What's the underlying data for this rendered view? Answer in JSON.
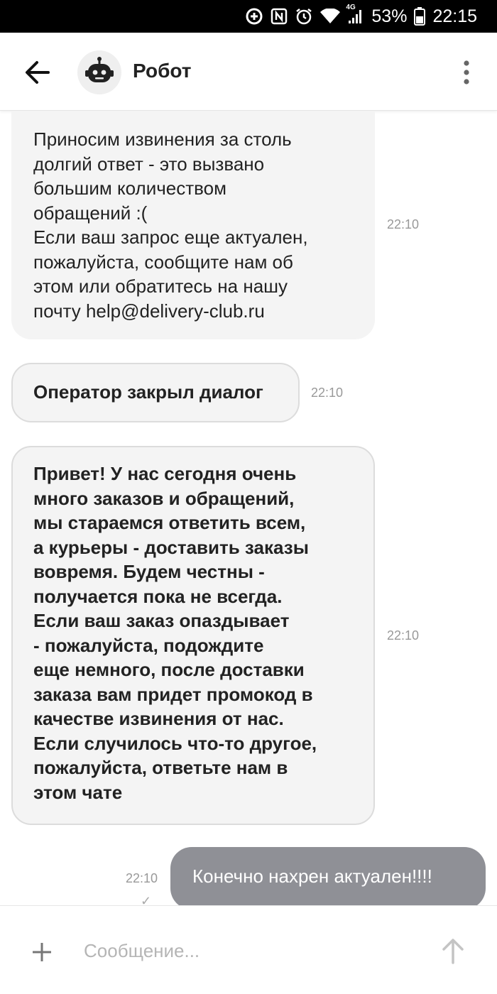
{
  "status_bar": {
    "battery": "53%",
    "time": "22:15",
    "network": "4G"
  },
  "header": {
    "title": "Робот",
    "back_icon": "arrow-left-icon",
    "avatar_icon": "robot-icon",
    "menu_icon": "more-vertical-icon"
  },
  "messages": [
    {
      "text": "Приносим извинения за столь\nдолгий ответ - это вызвано\nбольшим количеством\nобращений :(\nЕсли ваш запрос еще актуален,\nпожалуйста, сообщите нам об\nэтом или обратитесь на нашу\nпочту help@delivery-club.ru",
      "time": "22:10",
      "direction": "incoming"
    },
    {
      "text": "Оператор закрыл диалог",
      "time": "22:10",
      "direction": "incoming"
    },
    {
      "text": "Привет! У нас сегодня очень\nмного заказов и обращений,\nмы стараемся ответить всем,\nа курьеры - доставить заказы\nвовремя. Будем честны -\nполучается пока не всегда.\nЕсли ваш заказ опаздывает\n- пожалуйста, подождите\nеще немного, после доставки\nзаказа вам придет промокод в\nкачестве извинения от нас.\nЕсли случилось что-то другое,\nпожалуйста, ответьте нам в\nэтом чате",
      "time": "22:10",
      "direction": "incoming"
    },
    {
      "text": "Конечно нахрен актуален!!!!",
      "time": "22:10",
      "direction": "outgoing",
      "status": "sent"
    }
  ],
  "composer": {
    "placeholder": "Сообщение...",
    "attach_icon": "plus-icon",
    "send_icon": "arrow-up-icon"
  },
  "colors": {
    "incoming_bubble": "#f4f4f4",
    "outgoing_bubble": "#8f9096",
    "status_bar": "#000000"
  }
}
